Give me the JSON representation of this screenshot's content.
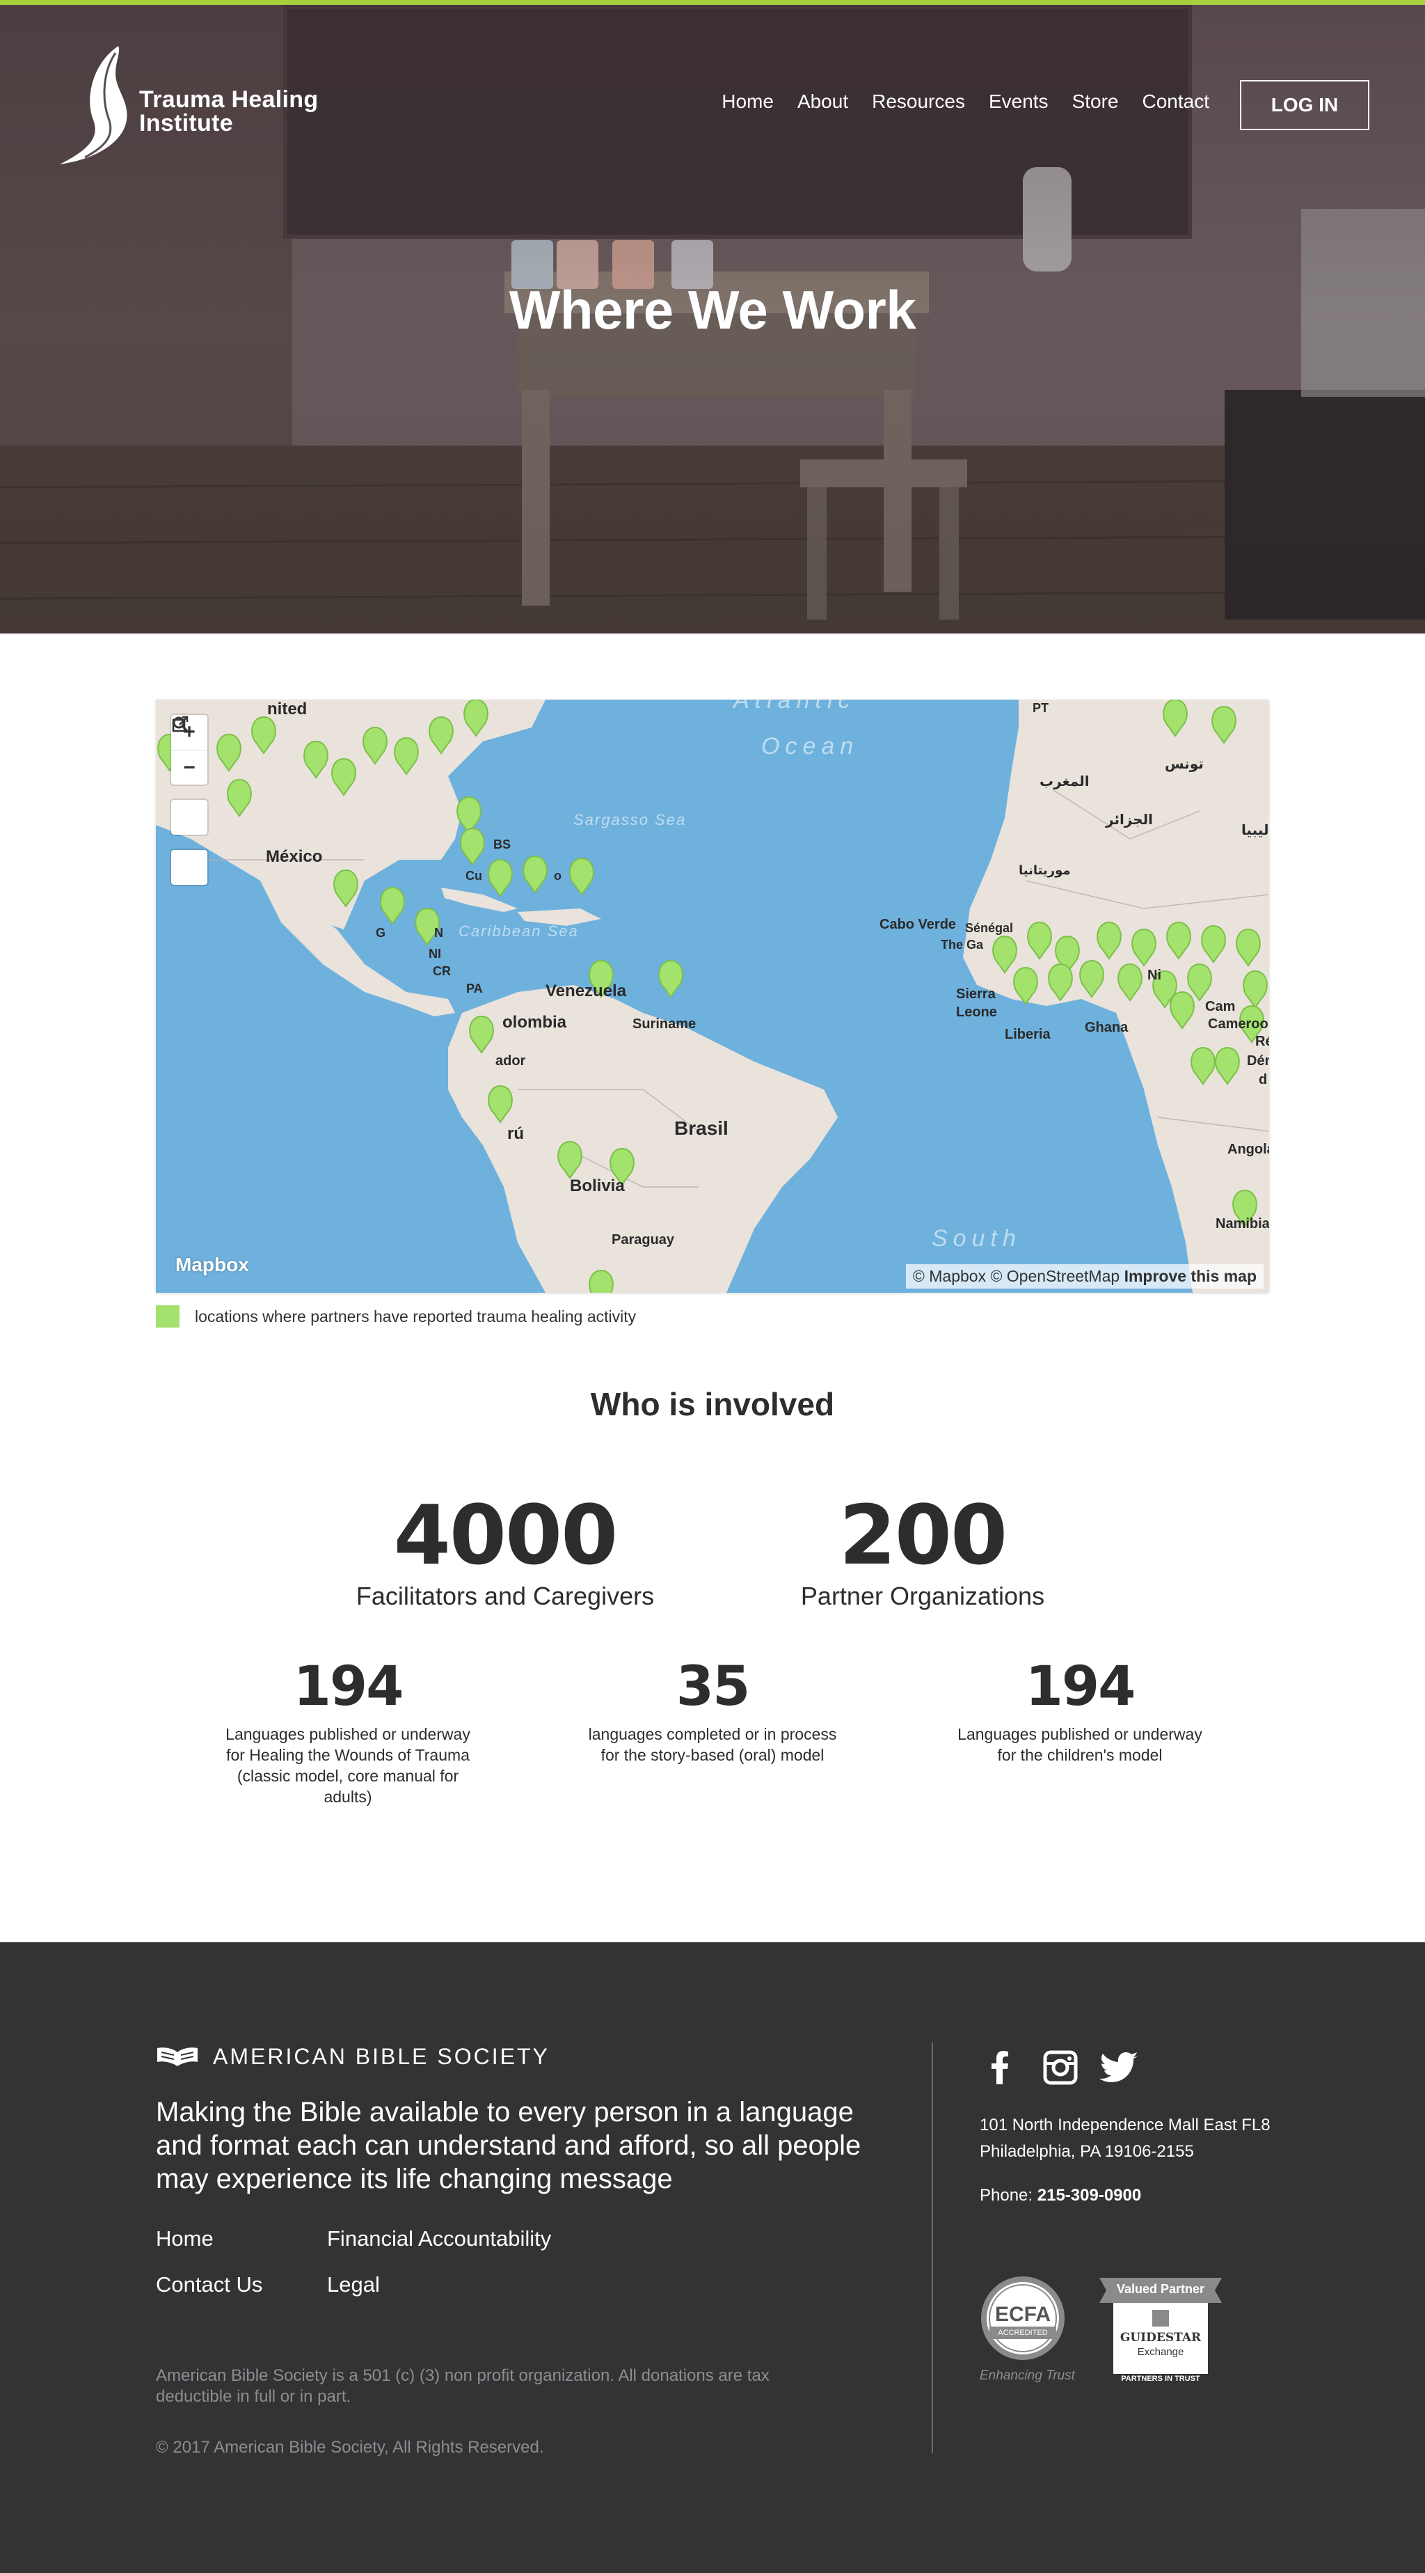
{
  "brand": {
    "logo_line1": "Trauma Healing",
    "logo_line2": "Institute",
    "accent": "#a8cf3c"
  },
  "nav": {
    "items": [
      "Home",
      "About",
      "Resources",
      "Events",
      "Store",
      "Contact"
    ],
    "login": "LOG IN"
  },
  "hero": {
    "title": "Where We Work"
  },
  "map": {
    "ocean_labels": [
      "Atlantic",
      "Ocean",
      "Sargasso Sea",
      "Caribbean Sea",
      "South"
    ],
    "place_labels": [
      "nited",
      "México",
      "BS",
      "Cu",
      "o",
      "G",
      "N",
      "NI",
      "CR",
      "PA",
      "Venezuela",
      "olombia",
      "Suriname",
      "ador",
      "rú",
      "Brasil",
      "Bolivia",
      "Paraguay",
      "PT",
      "المغرب",
      "تونس",
      "الجزائر",
      "ليبيا",
      "موريتانيا",
      "Cabo Verde",
      "Sénégal",
      "The Ga",
      "Sierra",
      "Leone",
      "Liberia",
      "Ghana",
      "Ni",
      "Cam",
      "Cameroon",
      "Ré",
      "Dém",
      "d",
      "Angola",
      "Namibia"
    ],
    "controls": {
      "zoom_in": "+",
      "zoom_out": "−",
      "search_icon": "search-icon",
      "share_icon": "external-link-icon"
    },
    "mapbox_logo": "Mapbox",
    "attribution_text": "© Mapbox © OpenStreetMap",
    "attribution_link": "Improve this map",
    "marker_color": "#a4e26e",
    "ocean_color": "#6fb1dd",
    "land_color": "#e9e3dc"
  },
  "legend": {
    "text": "locations where partners have reported trauma healing activity",
    "color": "#a4e26e"
  },
  "stats": {
    "title": "Who is involved",
    "primary": [
      {
        "value": "4000",
        "label": "Facilitators and Caregivers"
      },
      {
        "value": "200",
        "label": "Partner Organizations"
      }
    ],
    "secondary": [
      {
        "value": "194",
        "label_lines": [
          "Languages published or underway",
          "for Healing the Wounds of Trauma",
          "(classic model, core manual for",
          "adults)"
        ]
      },
      {
        "value": "35",
        "label_lines": [
          "languages completed or in process",
          "for the story-based (oral) model"
        ]
      },
      {
        "value": "194",
        "label_lines": [
          "Languages published or underway",
          "for the children's model"
        ]
      }
    ]
  },
  "footer": {
    "org_name": "AMERICAN BIBLE SOCIETY",
    "mission": "Making the Bible available to every person in a language and format each can understand and afford, so all people may experience its life changing message",
    "links": [
      "Home",
      "Financial Accountability",
      "Contact Us",
      "Legal"
    ],
    "legal_note": "American Bible Society is a 501 (c) (3) non profit organization. All donations are tax deductible in full or in part.",
    "copyright": "© 2017 American Bible Society, All Rights Reserved.",
    "social": [
      "facebook-icon",
      "instagram-icon",
      "twitter-icon"
    ],
    "address_line1": "101 North Independence Mall East FL8",
    "address_line2": "Philadelphia, PA 19106-2155",
    "phone_label": "Phone:",
    "phone_number": "215-309-0900",
    "ecfa": {
      "name": "ECFA",
      "sub": "ACCREDITED",
      "tagline": "Enhancing Trust"
    },
    "guidestar": {
      "ribbon": "Valued Partner",
      "name": "GUIDESTAR",
      "sub": "Exchange",
      "footer": "PARTNERS IN TRUST"
    },
    "background": "#333336"
  }
}
